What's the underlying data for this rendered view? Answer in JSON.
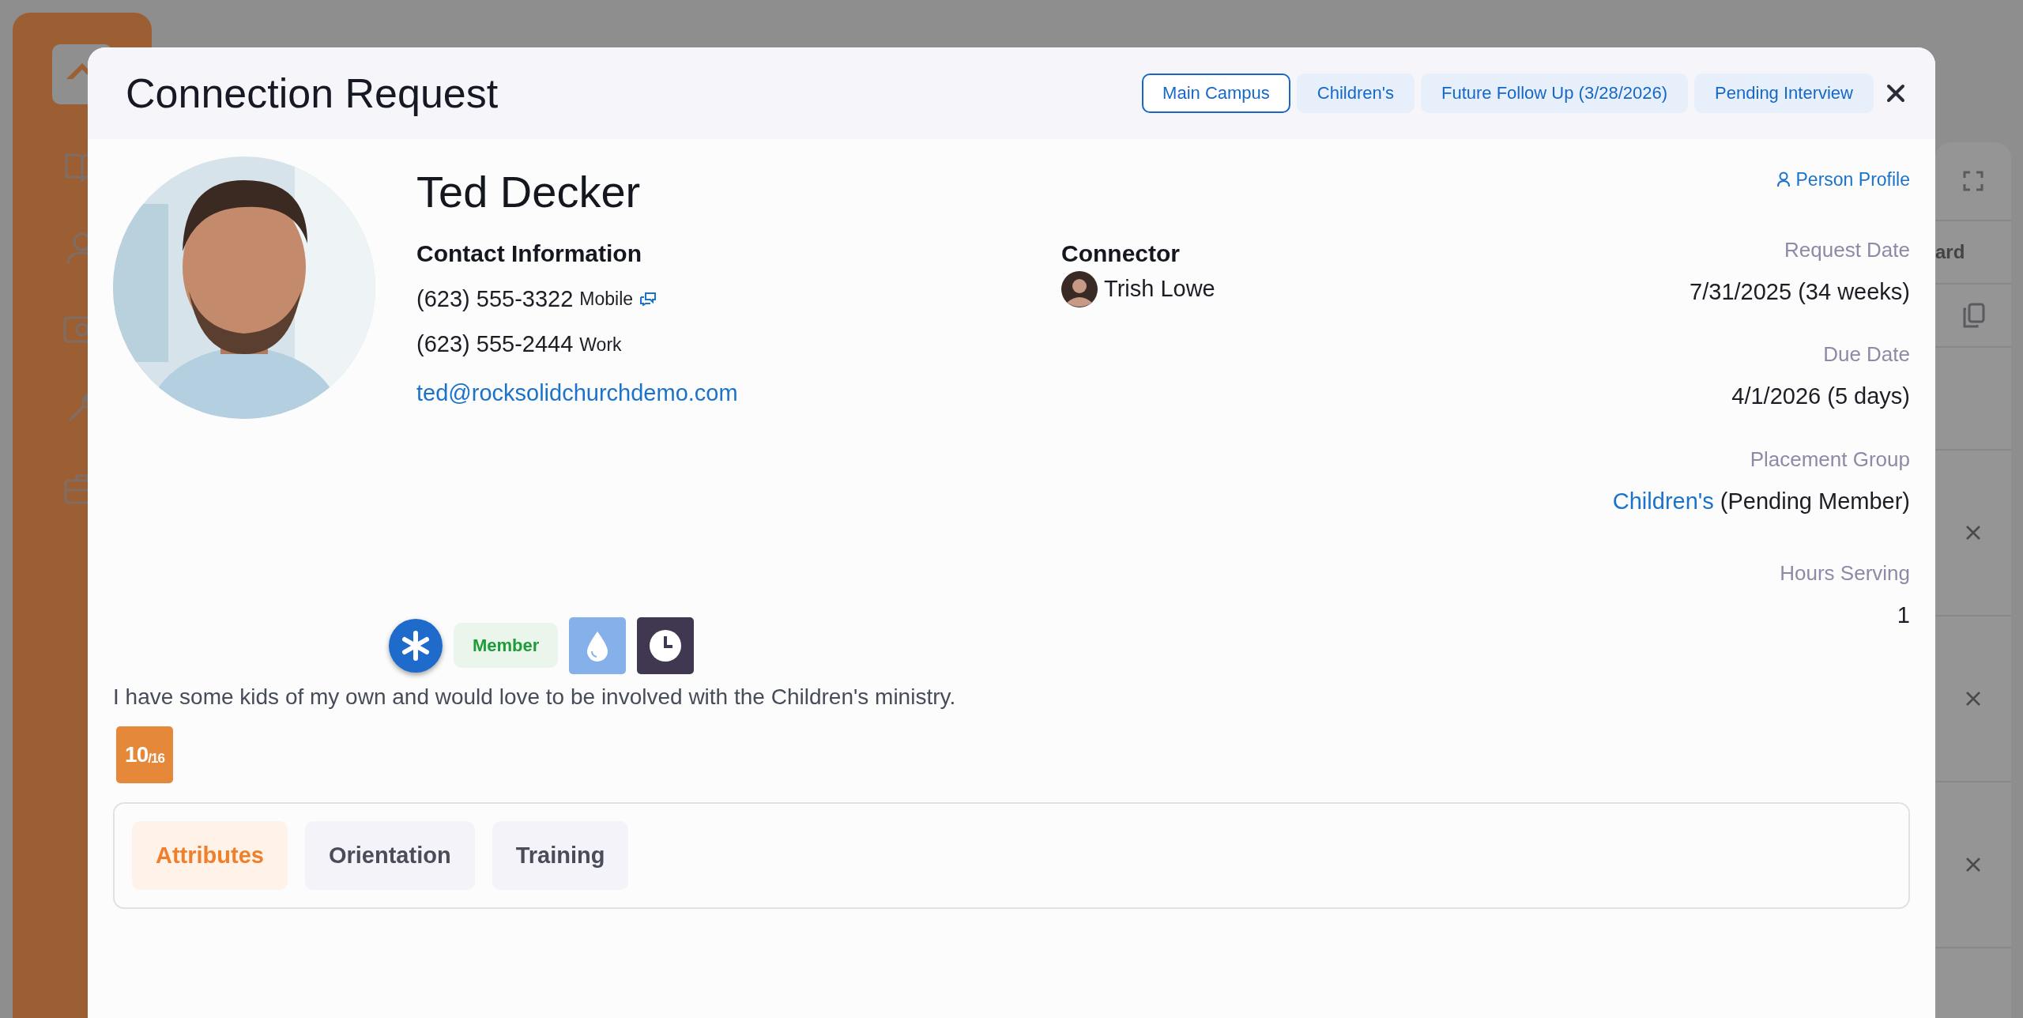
{
  "background": {
    "column_text": "ard"
  },
  "modal": {
    "title": "Connection Request",
    "tags": [
      {
        "label": "Main Campus",
        "kind": "outline"
      },
      {
        "label": "Children's",
        "kind": "soft"
      },
      {
        "label": "Future Follow Up (3/28/2026)",
        "kind": "soft"
      },
      {
        "label": "Pending Interview",
        "kind": "soft"
      }
    ],
    "profile_link": "Person Profile",
    "name": "Ted Decker",
    "contact": {
      "heading": "Contact Information",
      "phones": [
        {
          "number": "(623) 555-3322",
          "type": "Mobile",
          "sms": true
        },
        {
          "number": "(623) 555-2444",
          "type": "Work",
          "sms": false
        }
      ],
      "email": "ted@rocksolidchurchdemo.com"
    },
    "connector": {
      "heading": "Connector",
      "name": "Trish Lowe"
    },
    "details": [
      {
        "label": "Request Date",
        "value": "7/31/2025 (34 weeks)"
      },
      {
        "label": "Due Date",
        "value": "4/1/2026 (5 days)"
      },
      {
        "label": "Placement Group",
        "link": "Children's",
        "value": "(Pending Member)"
      },
      {
        "label": "Hours Serving",
        "value": "1"
      }
    ],
    "badges": [
      {
        "kind": "asterisk",
        "color": "#1f6bcc"
      },
      {
        "kind": "label",
        "label": "Member"
      },
      {
        "kind": "drop",
        "color": "#86b0ea"
      },
      {
        "kind": "clock",
        "color": "#403850"
      }
    ],
    "comment": "I have some kids of my own and would love to be involved with the Children's ministry.",
    "score": "10$_{/16}$",
    "tabs": [
      {
        "label": "Attributes",
        "selected": true
      },
      {
        "label": "Orientation",
        "selected": false
      },
      {
        "label": "Training",
        "selected": false
      }
    ]
  }
}
